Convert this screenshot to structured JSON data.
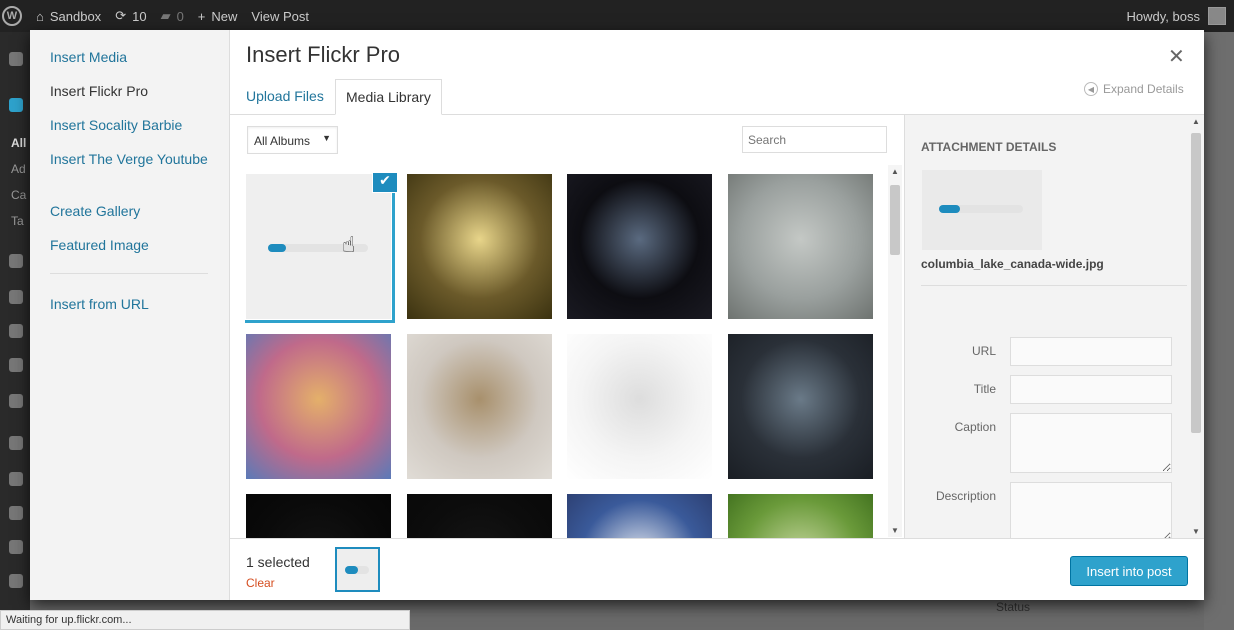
{
  "adminbar": {
    "site_name": "Sandbox",
    "updates_count": "10",
    "comments_count": "0",
    "new_label": "New",
    "view_post": "View Post",
    "greeting": "Howdy, boss"
  },
  "adminmenu": {
    "labels": [
      "All",
      "Ad",
      "Ca",
      "Ta"
    ]
  },
  "background": {
    "status_label": "Status"
  },
  "modal": {
    "menu": {
      "items": [
        {
          "label": "Insert Media",
          "active": false
        },
        {
          "label": "Insert Flickr Pro",
          "active": true
        },
        {
          "label": "Insert Socality Barbie",
          "active": false
        },
        {
          "label": "Insert The Verge Youtube",
          "active": false
        },
        {
          "label": "Create Gallery",
          "active": false
        },
        {
          "label": "Featured Image",
          "active": false
        }
      ],
      "url_item": "Insert from URL"
    },
    "title": "Insert Flickr Pro",
    "close_glyph": "✕",
    "tabs": [
      {
        "label": "Upload Files",
        "active": false
      },
      {
        "label": "Media Library",
        "active": true
      }
    ],
    "expand_details": "Expand Details",
    "filter": {
      "selected": "All Albums"
    },
    "search": {
      "placeholder": "Search"
    },
    "thumbnails": [
      {
        "name": "thumb-uploading",
        "selected": true,
        "progress": 0.18
      },
      {
        "name": "thumb-field-sunset",
        "colors": [
          "#6b5a2a",
          "#e8d58a",
          "#3b3210"
        ]
      },
      {
        "name": "thumb-tunnel",
        "colors": [
          "#0d0d12",
          "#5a6a80",
          "#1a1a22"
        ]
      },
      {
        "name": "thumb-rain-window",
        "colors": [
          "#9aa09e",
          "#c4c8c5",
          "#6e7370"
        ]
      },
      {
        "name": "thumb-colorful-blur",
        "colors": [
          "#c06a8a",
          "#e4b06a",
          "#5a7ab8"
        ]
      },
      {
        "name": "thumb-blurry-room",
        "colors": [
          "#cfc8c0",
          "#a8906c",
          "#e0dcd6"
        ]
      },
      {
        "name": "thumb-instagram-screenshot",
        "colors": [
          "#f4f4f4",
          "#dddddd",
          "#ffffff"
        ]
      },
      {
        "name": "thumb-rocky-coast",
        "colors": [
          "#2a3038",
          "#6a7a88",
          "#1a1e24"
        ]
      },
      {
        "name": "thumb-dark-1",
        "colors": [
          "#0a0a0a",
          "#141414",
          "#050505"
        ]
      },
      {
        "name": "thumb-dark-2",
        "colors": [
          "#0c0c0c",
          "#161616",
          "#080808"
        ]
      },
      {
        "name": "thumb-blossoms-sky",
        "colors": [
          "#3a5a9a",
          "#e8ecf2",
          "#2a3a6a"
        ]
      },
      {
        "name": "thumb-green-leaves",
        "colors": [
          "#6a9a3a",
          "#c8d8a0",
          "#3a6a1a"
        ]
      }
    ],
    "sidebar": {
      "heading": "ATTACHMENT DETAILS",
      "filename": "columbia_lake_canada-wide.jpg",
      "progress": 0.25,
      "fields": [
        {
          "label": "URL",
          "value": ""
        },
        {
          "label": "Title",
          "value": ""
        },
        {
          "label": "Caption",
          "value": ""
        },
        {
          "label": "Description",
          "value": ""
        }
      ]
    },
    "toolbar": {
      "selected_count": "1 selected",
      "clear": "Clear",
      "mini_progress": 0.55,
      "insert_button": "Insert into post"
    }
  },
  "statusbar": {
    "text": "Waiting for up.flickr.com..."
  },
  "colors": {
    "accent": "#2ea2cc",
    "link": "#21759b",
    "clear": "#d54e21"
  }
}
